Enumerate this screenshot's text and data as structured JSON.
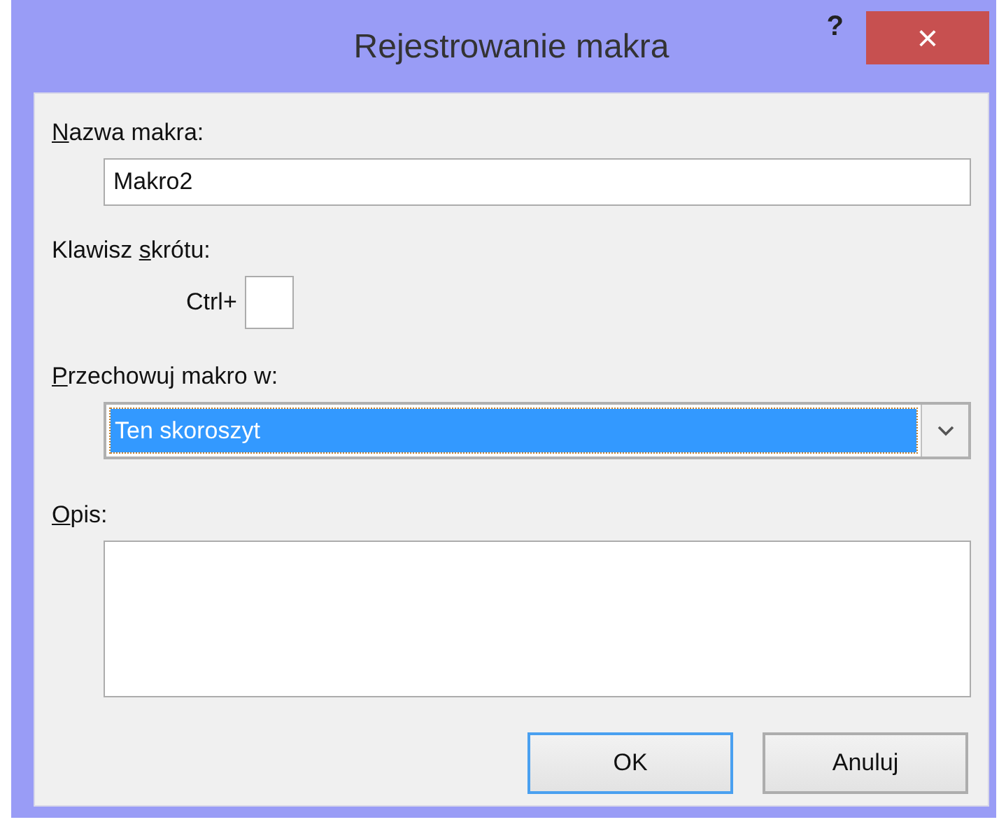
{
  "window": {
    "title": "Rejestrowanie makra",
    "help": "?",
    "close": "×"
  },
  "fields": [
    {
      "kind": "text",
      "label": {
        "key": "N",
        "after": "azwa makra:"
      },
      "value": "Makro2"
    },
    {
      "kind": "shortcut",
      "label": {
        "before": "Klawisz ",
        "key": "s",
        "after": "krótu:"
      },
      "prefix": "Ctrl+"
    },
    {
      "kind": "combo",
      "label": {
        "key": "P",
        "after": "rzechowuj makro w:"
      },
      "value": "Ten skoroszyt",
      "selected": true
    },
    {
      "kind": "memo",
      "label": {
        "key": "O",
        "after": "pis:"
      }
    }
  ],
  "buttons": [
    {
      "label": "OK",
      "default": true
    },
    {
      "label": "Anuluj",
      "default": false
    }
  ]
}
